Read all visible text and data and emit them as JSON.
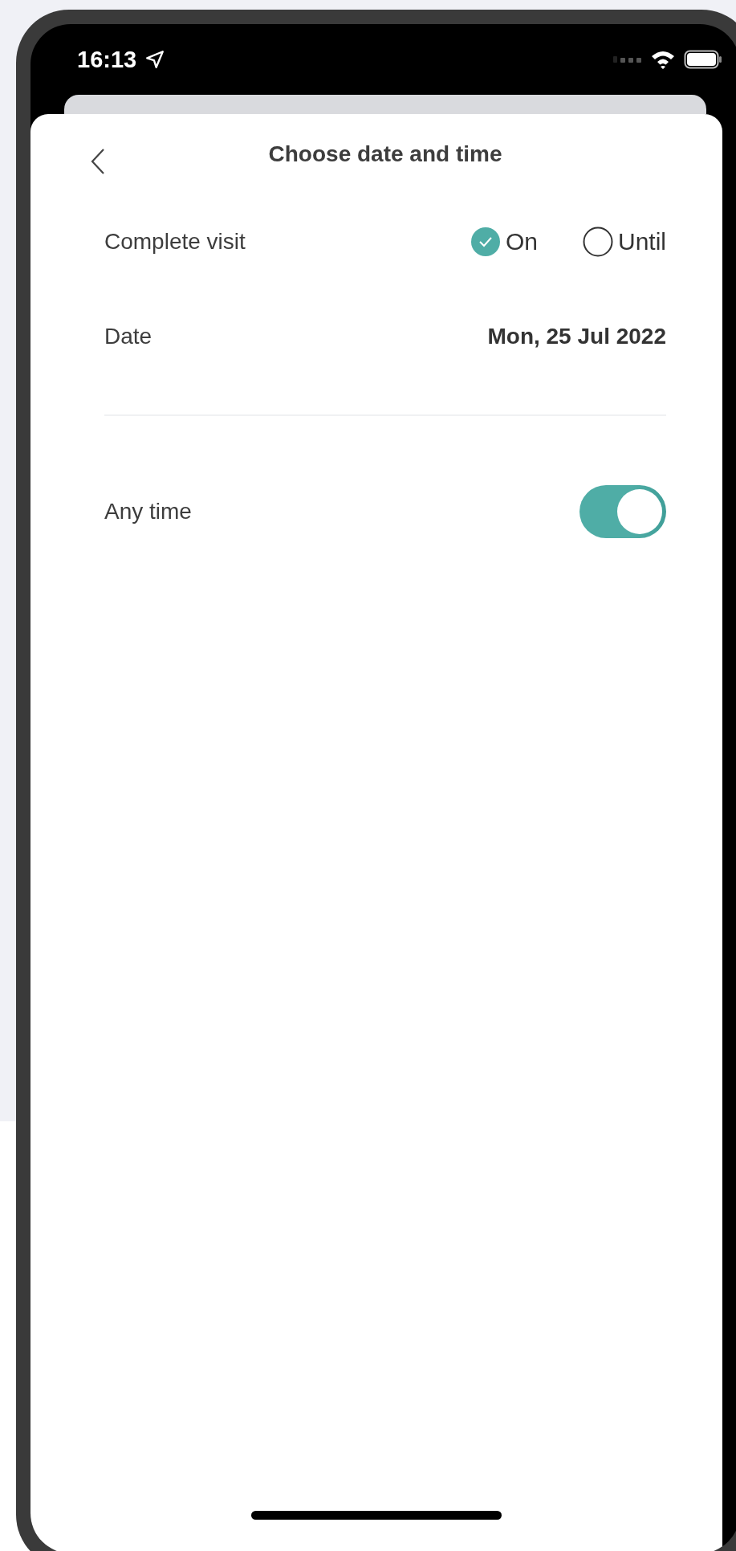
{
  "status_bar": {
    "time": "16:13"
  },
  "header": {
    "title": "Choose date and time"
  },
  "complete_visit": {
    "label": "Complete visit",
    "options": [
      {
        "label": "On",
        "selected": true
      },
      {
        "label": "Until",
        "selected": false
      }
    ]
  },
  "date": {
    "label": "Date",
    "value": "Mon, 25 Jul 2022"
  },
  "any_time": {
    "label": "Any time",
    "on": true
  }
}
